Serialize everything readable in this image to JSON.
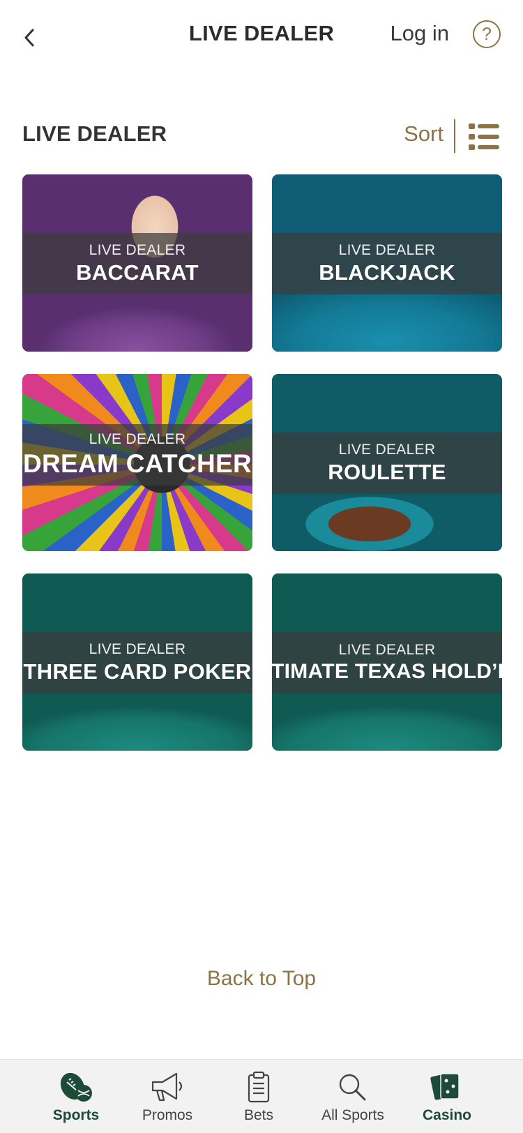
{
  "header": {
    "title": "LIVE DEALER",
    "login_label": "Log in",
    "help_label": "?"
  },
  "section": {
    "title": "LIVE DEALER",
    "sort_label": "Sort"
  },
  "games": [
    {
      "subtitle": "LIVE DEALER",
      "name": "BACCARAT"
    },
    {
      "subtitle": "LIVE DEALER",
      "name": "BLACKJACK"
    },
    {
      "subtitle": "LIVE DEALER",
      "name": "DREAM CATCHER"
    },
    {
      "subtitle": "LIVE DEALER",
      "name": "ROULETTE"
    },
    {
      "subtitle": "LIVE DEALER",
      "name": "THREE CARD POKER"
    },
    {
      "subtitle": "LIVE DEALER",
      "name": "ULTIMATE TEXAS HOLD’EM"
    }
  ],
  "back_to_top": "Back to Top",
  "nav": {
    "items": [
      {
        "label": "Sports",
        "icon": "sports-icon",
        "active": false
      },
      {
        "label": "Promos",
        "icon": "megaphone-icon",
        "active": false
      },
      {
        "label": "Bets",
        "icon": "clipboard-icon",
        "active": false
      },
      {
        "label": "All Sports",
        "icon": "search-icon",
        "active": false
      },
      {
        "label": "Casino",
        "icon": "casino-cards-icon",
        "active": true
      }
    ]
  },
  "colors": {
    "accent": "#8b7347",
    "active_nav": "#1e4a3a",
    "nav_bg": "#f2f2f2"
  }
}
